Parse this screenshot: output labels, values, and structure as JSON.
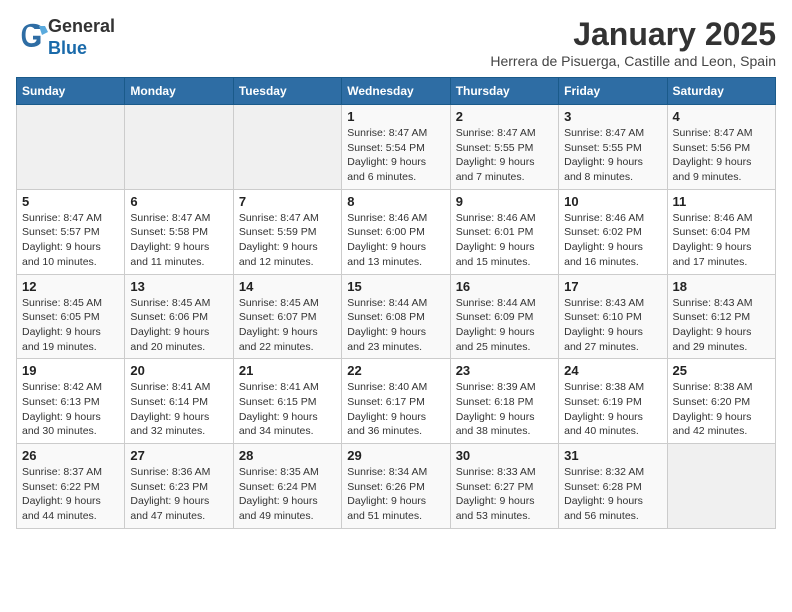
{
  "header": {
    "logo_line1": "General",
    "logo_line2": "Blue",
    "month": "January 2025",
    "location": "Herrera de Pisuerga, Castille and Leon, Spain"
  },
  "days_of_week": [
    "Sunday",
    "Monday",
    "Tuesday",
    "Wednesday",
    "Thursday",
    "Friday",
    "Saturday"
  ],
  "weeks": [
    [
      {
        "day": "",
        "info": ""
      },
      {
        "day": "",
        "info": ""
      },
      {
        "day": "",
        "info": ""
      },
      {
        "day": "1",
        "info": "Sunrise: 8:47 AM\nSunset: 5:54 PM\nDaylight: 9 hours and 6 minutes."
      },
      {
        "day": "2",
        "info": "Sunrise: 8:47 AM\nSunset: 5:55 PM\nDaylight: 9 hours and 7 minutes."
      },
      {
        "day": "3",
        "info": "Sunrise: 8:47 AM\nSunset: 5:55 PM\nDaylight: 9 hours and 8 minutes."
      },
      {
        "day": "4",
        "info": "Sunrise: 8:47 AM\nSunset: 5:56 PM\nDaylight: 9 hours and 9 minutes."
      }
    ],
    [
      {
        "day": "5",
        "info": "Sunrise: 8:47 AM\nSunset: 5:57 PM\nDaylight: 9 hours and 10 minutes."
      },
      {
        "day": "6",
        "info": "Sunrise: 8:47 AM\nSunset: 5:58 PM\nDaylight: 9 hours and 11 minutes."
      },
      {
        "day": "7",
        "info": "Sunrise: 8:47 AM\nSunset: 5:59 PM\nDaylight: 9 hours and 12 minutes."
      },
      {
        "day": "8",
        "info": "Sunrise: 8:46 AM\nSunset: 6:00 PM\nDaylight: 9 hours and 13 minutes."
      },
      {
        "day": "9",
        "info": "Sunrise: 8:46 AM\nSunset: 6:01 PM\nDaylight: 9 hours and 15 minutes."
      },
      {
        "day": "10",
        "info": "Sunrise: 8:46 AM\nSunset: 6:02 PM\nDaylight: 9 hours and 16 minutes."
      },
      {
        "day": "11",
        "info": "Sunrise: 8:46 AM\nSunset: 6:04 PM\nDaylight: 9 hours and 17 minutes."
      }
    ],
    [
      {
        "day": "12",
        "info": "Sunrise: 8:45 AM\nSunset: 6:05 PM\nDaylight: 9 hours and 19 minutes."
      },
      {
        "day": "13",
        "info": "Sunrise: 8:45 AM\nSunset: 6:06 PM\nDaylight: 9 hours and 20 minutes."
      },
      {
        "day": "14",
        "info": "Sunrise: 8:45 AM\nSunset: 6:07 PM\nDaylight: 9 hours and 22 minutes."
      },
      {
        "day": "15",
        "info": "Sunrise: 8:44 AM\nSunset: 6:08 PM\nDaylight: 9 hours and 23 minutes."
      },
      {
        "day": "16",
        "info": "Sunrise: 8:44 AM\nSunset: 6:09 PM\nDaylight: 9 hours and 25 minutes."
      },
      {
        "day": "17",
        "info": "Sunrise: 8:43 AM\nSunset: 6:10 PM\nDaylight: 9 hours and 27 minutes."
      },
      {
        "day": "18",
        "info": "Sunrise: 8:43 AM\nSunset: 6:12 PM\nDaylight: 9 hours and 29 minutes."
      }
    ],
    [
      {
        "day": "19",
        "info": "Sunrise: 8:42 AM\nSunset: 6:13 PM\nDaylight: 9 hours and 30 minutes."
      },
      {
        "day": "20",
        "info": "Sunrise: 8:41 AM\nSunset: 6:14 PM\nDaylight: 9 hours and 32 minutes."
      },
      {
        "day": "21",
        "info": "Sunrise: 8:41 AM\nSunset: 6:15 PM\nDaylight: 9 hours and 34 minutes."
      },
      {
        "day": "22",
        "info": "Sunrise: 8:40 AM\nSunset: 6:17 PM\nDaylight: 9 hours and 36 minutes."
      },
      {
        "day": "23",
        "info": "Sunrise: 8:39 AM\nSunset: 6:18 PM\nDaylight: 9 hours and 38 minutes."
      },
      {
        "day": "24",
        "info": "Sunrise: 8:38 AM\nSunset: 6:19 PM\nDaylight: 9 hours and 40 minutes."
      },
      {
        "day": "25",
        "info": "Sunrise: 8:38 AM\nSunset: 6:20 PM\nDaylight: 9 hours and 42 minutes."
      }
    ],
    [
      {
        "day": "26",
        "info": "Sunrise: 8:37 AM\nSunset: 6:22 PM\nDaylight: 9 hours and 44 minutes."
      },
      {
        "day": "27",
        "info": "Sunrise: 8:36 AM\nSunset: 6:23 PM\nDaylight: 9 hours and 47 minutes."
      },
      {
        "day": "28",
        "info": "Sunrise: 8:35 AM\nSunset: 6:24 PM\nDaylight: 9 hours and 49 minutes."
      },
      {
        "day": "29",
        "info": "Sunrise: 8:34 AM\nSunset: 6:26 PM\nDaylight: 9 hours and 51 minutes."
      },
      {
        "day": "30",
        "info": "Sunrise: 8:33 AM\nSunset: 6:27 PM\nDaylight: 9 hours and 53 minutes."
      },
      {
        "day": "31",
        "info": "Sunrise: 8:32 AM\nSunset: 6:28 PM\nDaylight: 9 hours and 56 minutes."
      },
      {
        "day": "",
        "info": ""
      }
    ]
  ]
}
